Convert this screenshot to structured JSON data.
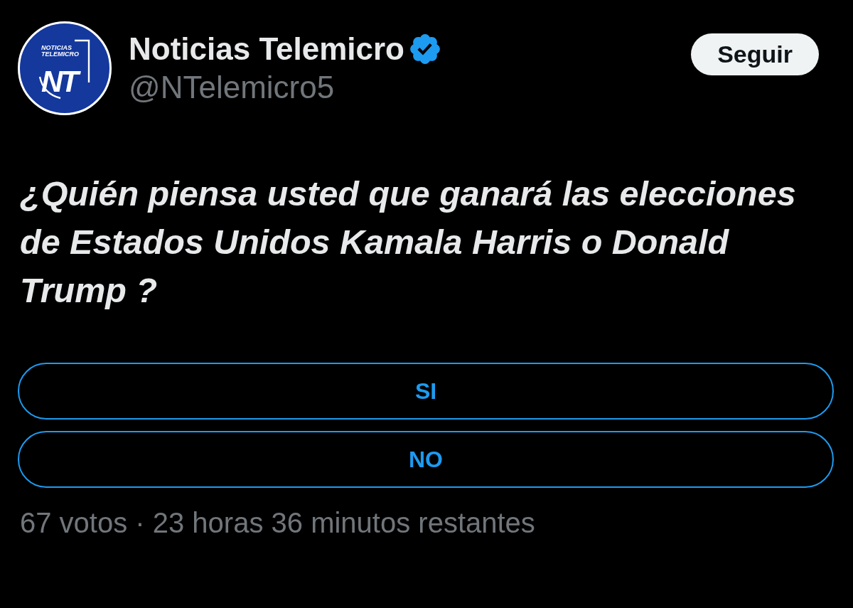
{
  "tweet": {
    "author": {
      "avatar": {
        "caption_lines": [
          "NOTICIAS",
          "TELEMICRO"
        ],
        "monogram": "NT"
      },
      "name": "Noticias Telemicro",
      "verified": true,
      "handle": "@NTelemicro5"
    },
    "follow_button": "Seguir",
    "text": "¿Quién piensa usted que ganará las elecciones de Estados Unidos Kamala Harris o Donald Trump ?",
    "poll": {
      "options": [
        {
          "label": "SI"
        },
        {
          "label": "NO"
        }
      ],
      "status": "67 votos · 23 horas 36 minutos restantes"
    }
  }
}
